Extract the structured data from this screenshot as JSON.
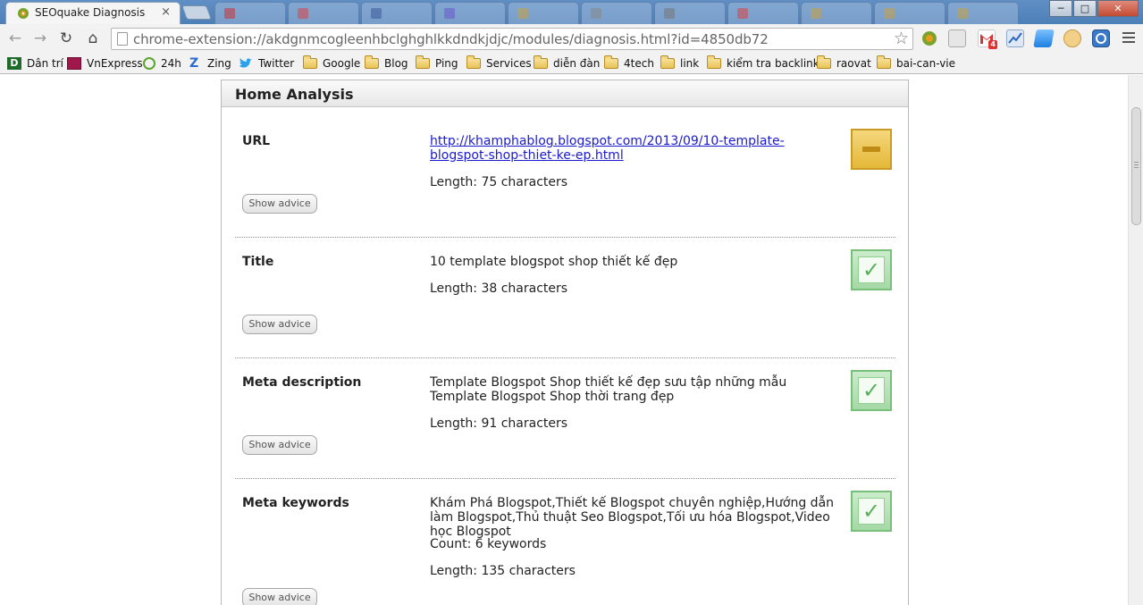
{
  "tab": {
    "title": "SEOquake Diagnosis",
    "close_glyph": "×"
  },
  "window_controls": {
    "minimize": "─",
    "maximize": "□",
    "close": "✕"
  },
  "toolbar": {
    "back_glyph": "←",
    "forward_glyph": "→",
    "reload_glyph": "↻",
    "home_glyph": "⌂",
    "url": "chrome-extension://akdgnmcogleenhbclghghlkkdndkjdjc/modules/diagnosis.html?id=4850db72",
    "star_glyph": "☆",
    "gmail_badge": "4"
  },
  "bookmarks": [
    {
      "label": "Dân trí",
      "icon": "dantri-icon",
      "folder": false
    },
    {
      "label": "VnExpress",
      "icon": "vnexpress-icon",
      "folder": false
    },
    {
      "label": "24h",
      "icon": "24h-icon",
      "folder": false
    },
    {
      "label": "Zing",
      "icon": "zing-icon",
      "folder": false
    },
    {
      "label": "Twitter",
      "icon": "twitter-icon",
      "folder": false
    },
    {
      "label": "Google",
      "icon": "folder-icon",
      "folder": true
    },
    {
      "label": "Blog",
      "icon": "folder-icon",
      "folder": true
    },
    {
      "label": "Ping",
      "icon": "folder-icon",
      "folder": true
    },
    {
      "label": "Services",
      "icon": "folder-icon",
      "folder": true
    },
    {
      "label": "diễn đàn",
      "icon": "folder-icon",
      "folder": true
    },
    {
      "label": "4tech",
      "icon": "folder-icon",
      "folder": true
    },
    {
      "label": "link",
      "icon": "folder-icon",
      "folder": true
    },
    {
      "label": "kiểm tra backlink",
      "icon": "folder-icon",
      "folder": true
    },
    {
      "label": "raovat",
      "icon": "folder-icon",
      "folder": true
    },
    {
      "label": "bai-can-vie",
      "icon": "folder-icon",
      "folder": true
    }
  ],
  "panel": {
    "title": "Home Analysis",
    "advice_label": "Show advice",
    "rows": [
      {
        "label": "URL",
        "value": "http://khamphablog.blogspot.com/2013/09/10-template-blogspot-shop-thiet-ke-ep.html",
        "is_link": true,
        "metas": [
          "Length: 75 characters"
        ],
        "status": "warning"
      },
      {
        "label": "Title",
        "value": "10 template blogspot shop thiết kế đẹp",
        "is_link": false,
        "metas": [
          "Length: 38 characters"
        ],
        "status": "ok"
      },
      {
        "label": "Meta description",
        "value": "Template Blogspot Shop thiết kế đẹp sưu tập những mẫu Template Blogspot Shop thời trang đẹp",
        "is_link": false,
        "metas": [
          "Length: 91 characters"
        ],
        "status": "ok"
      },
      {
        "label": "Meta keywords",
        "value": "Khám Phá Blogspot,Thiết kế Blogspot chuyên nghiệp,Hướng dẫn làm Blogspot,Thủ thuật Seo Blogspot,Tối ưu hóa Blogspot,Video học Blogspot",
        "is_link": false,
        "metas": [
          "Count: 6 keywords",
          "Length: 135 characters"
        ],
        "status": "ok"
      }
    ]
  },
  "colors": {
    "tabstrip": "#5f8fc4",
    "link": "#1a1ad0",
    "ok": "#58b05a",
    "warning": "#e4b838"
  }
}
